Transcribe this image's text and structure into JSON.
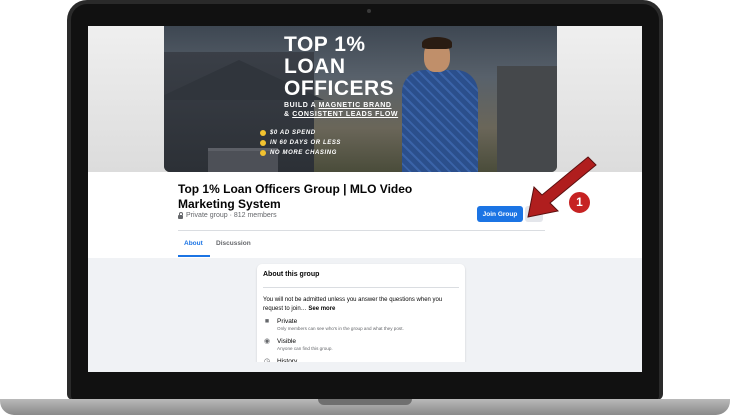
{
  "cover": {
    "title": "TOP 1%\nLOAN\nOFFICERS",
    "line1_pre": "BUILD A ",
    "line1_highlight": "MAGNETIC BRAND",
    "line2_pre": "& ",
    "line2_highlight": "CONSISTENT LEADS FLOW",
    "bullets": [
      "$0 AD SPEND",
      "IN 60 DAYS OR LESS",
      "NO MORE CHASING"
    ]
  },
  "group": {
    "title": "Top 1% Loan Officers Group | MLO Video Marketing System",
    "meta": "Private group · 812 members",
    "join_label": "Join Group",
    "more_icon": "chevron-down-icon"
  },
  "tabs": [
    {
      "label": "About",
      "active": true
    },
    {
      "label": "Discussion",
      "active": false
    }
  ],
  "about": {
    "title": "About this group",
    "description": "You will not be admitted unless you answer the questions when you request to join…",
    "see_more": "See more",
    "items": [
      {
        "icon": "lock-icon",
        "title": "Private",
        "subtitle": "Only members can see who's in the group and what they post."
      },
      {
        "icon": "eye-icon",
        "title": "Visible",
        "subtitle": "Anyone can find this group."
      },
      {
        "icon": "clock-icon",
        "title": "History",
        "subtitle": ""
      }
    ]
  },
  "callout": {
    "number": "1",
    "color": "#c62222"
  },
  "colors": {
    "primary": "#1b74e4",
    "background": "#f0f2f5"
  }
}
